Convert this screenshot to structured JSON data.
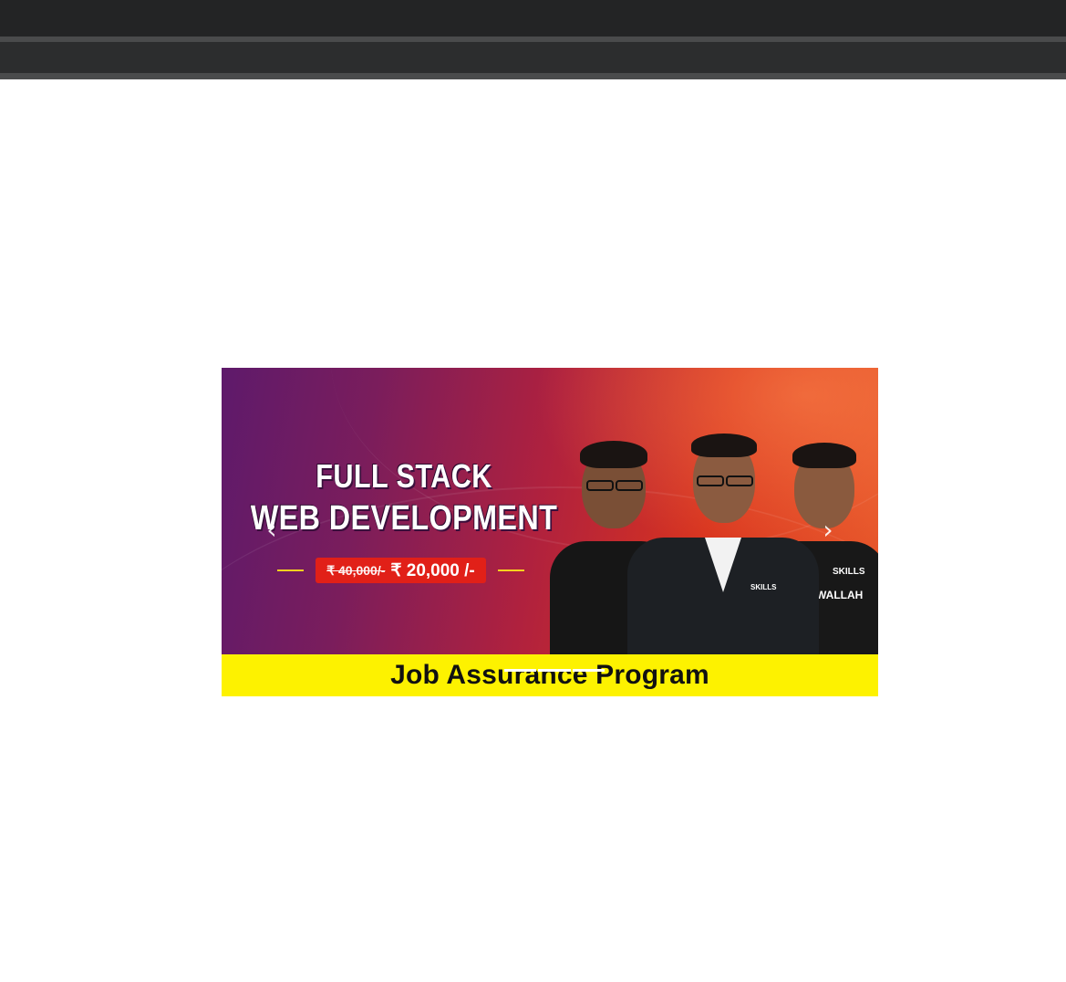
{
  "banner": {
    "title_line1": "FULL STACK",
    "title_line2": "WEB DEVELOPMENT",
    "price_old": "₹ 40,000/-",
    "price_new": "₹ 20,000 /-",
    "badge_center": "SKILLS",
    "badge_right_top": "SKILLS",
    "badge_right": "WALLAH",
    "footer": "Job Assurance Program",
    "prev_icon": "‹",
    "next_icon": "›"
  },
  "carousel": {
    "slide_count": 3,
    "active_index": 0
  },
  "colors": {
    "topbar": "#232425",
    "footer_strip": "#fdf200",
    "price_box": "#e12018"
  }
}
